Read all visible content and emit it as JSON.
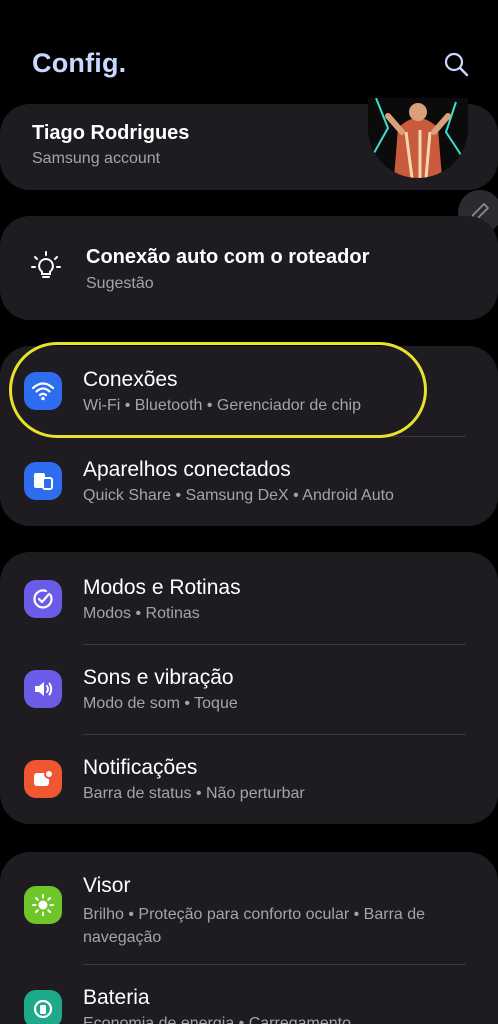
{
  "header": {
    "title": "Config."
  },
  "profile": {
    "name": "Tiago Rodrigues",
    "account": "Samsung account"
  },
  "suggestion": {
    "title": "Conexão auto com o roteador",
    "subtitle": "Sugestão"
  },
  "groups": [
    {
      "items": [
        {
          "title": "Conexões",
          "subtitle": "Wi-Fi  •  Bluetooth  •  Gerenciador de chip",
          "color": "#2f6df0",
          "icon": "wifi-icon"
        },
        {
          "title": "Aparelhos conectados",
          "subtitle": "Quick Share  •  Samsung DeX  •  Android Auto",
          "color": "#2f6df0",
          "icon": "devices-icon"
        }
      ]
    },
    {
      "items": [
        {
          "title": "Modos e Rotinas",
          "subtitle": "Modos  •  Rotinas",
          "color": "#6a5ce6",
          "icon": "check-circle-icon"
        },
        {
          "title": "Sons e vibração",
          "subtitle": "Modo de som  •  Toque",
          "color": "#6a5ce6",
          "icon": "volume-icon"
        },
        {
          "title": "Notificações",
          "subtitle": "Barra de status  •  Não perturbar",
          "color": "#f0562f",
          "icon": "notification-icon"
        }
      ]
    },
    {
      "items": [
        {
          "title": "Visor",
          "subtitle": "Brilho  •  Proteção para conforto ocular  •  Barra de navegação",
          "color": "#6ec62a",
          "icon": "sun-icon"
        },
        {
          "title": "Bateria",
          "subtitle": "Economia de energia  •  Carregamento",
          "color": "#1fa98b",
          "icon": "battery-icon"
        }
      ]
    }
  ],
  "colors": {
    "highlight": "#e8e22c",
    "card": "#1e1c21",
    "title": "#c9d8ff"
  }
}
